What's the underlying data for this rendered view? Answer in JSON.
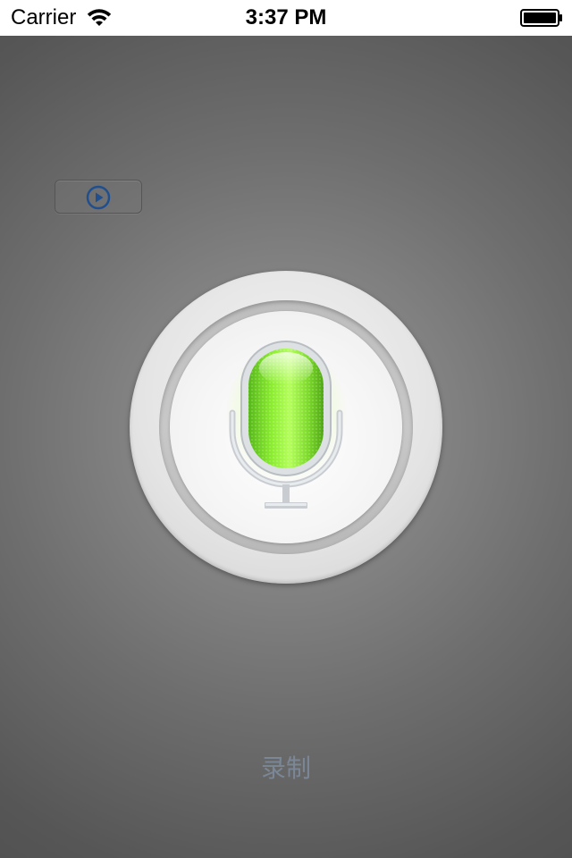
{
  "status_bar": {
    "carrier": "Carrier",
    "time": "3:37 PM",
    "icons": [
      "wifi-icon",
      "battery-icon"
    ]
  },
  "player": {
    "icon": "play-icon",
    "accent_color": "#1f4f8f"
  },
  "recorder": {
    "icon": "microphone-icon",
    "mic_color": "#7be02a",
    "label": "录制",
    "label_color": "#7b8796"
  }
}
